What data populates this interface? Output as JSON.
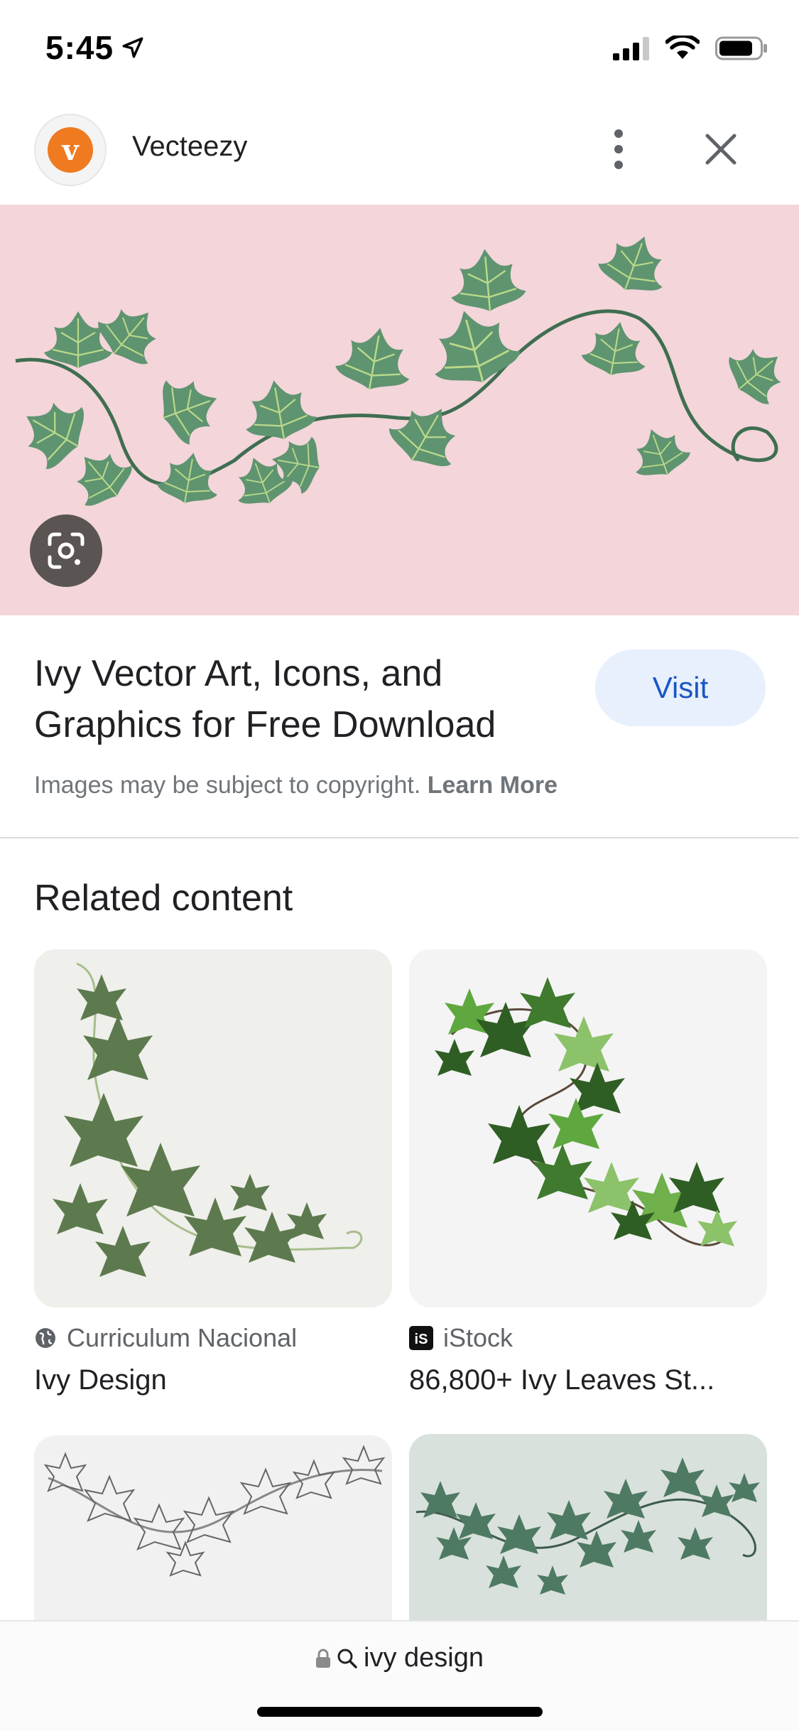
{
  "status_bar": {
    "time": "5:45"
  },
  "header": {
    "site_name": "Vecteezy",
    "logo_letter": "v"
  },
  "result": {
    "title": "Ivy Vector Art, Icons, and Graphics for Free Download",
    "visit_label": "Visit",
    "copyright_text": "Images may be subject to copyright.",
    "learn_more_label": "Learn More"
  },
  "related": {
    "heading": "Related content",
    "cards": [
      {
        "source": "Curriculum Nacional",
        "title": "Ivy Design"
      },
      {
        "source": "iStock",
        "title": "86,800+ Ivy Leaves St..."
      }
    ]
  },
  "bottom_bar": {
    "query": "ivy design"
  },
  "colors": {
    "hero_background": "#f3d5da",
    "leaf": "#5f9470",
    "visit_button_bg": "#e8f0fe",
    "visit_button_text": "#1a56c4",
    "logo_orange": "#f07a1f"
  }
}
